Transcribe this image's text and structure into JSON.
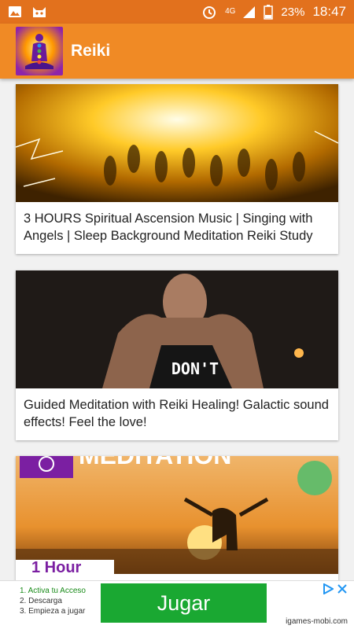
{
  "status_bar": {
    "network": "4G",
    "battery": "23%",
    "time": "18:47",
    "icons": [
      "gallery-icon",
      "cat-icon",
      "alarm-icon",
      "signal-icon",
      "battery-icon"
    ]
  },
  "app_bar": {
    "title": "Reiki",
    "color": "#f08a25"
  },
  "videos": [
    {
      "title": "3 HOURS Spiritual Ascension Music | Singing with Angels | Sleep Background Meditation Reiki Study"
    },
    {
      "title": "Guided Meditation with Reiki Healing!  Galactic sound effects!  Feel the love!",
      "shirt_text": "DON'T"
    },
    {
      "title": "",
      "banner_text": "MEDITATION",
      "badge_text": "1 Hour"
    }
  ],
  "ad": {
    "steps": [
      "1. Activa tu Acceso",
      "2. Descarga",
      "3. Empieza a jugar"
    ],
    "button": "Jugar",
    "domain": "igames-mobi.com",
    "choice_icons": [
      "ad-choices-icon",
      "close-icon"
    ]
  }
}
